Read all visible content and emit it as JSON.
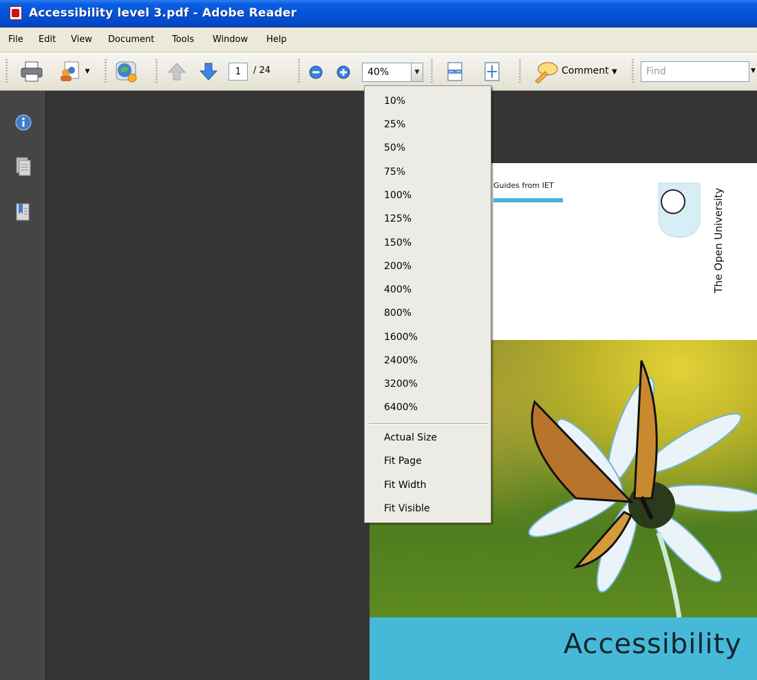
{
  "window": {
    "title": "Accessibility level 3.pdf - Adobe Reader"
  },
  "menubar": [
    "File",
    "Edit",
    "View",
    "Document",
    "Tools",
    "Window",
    "Help"
  ],
  "toolbar": {
    "page_current": "1",
    "page_total": "/ 24",
    "zoom_value": "40%",
    "comment_label": "Comment",
    "find_placeholder": "Find",
    "icons": [
      "print-icon",
      "collaborate-icon",
      "secure-icon",
      "previous-page-icon",
      "next-page-icon",
      "zoom-out-icon",
      "zoom-in-icon",
      "fit-width-icon",
      "fit-page-icon",
      "comment-icon"
    ]
  },
  "sidebar": {
    "icons": [
      "info-icon",
      "pages-icon",
      "bookmarks-icon"
    ]
  },
  "zoom_menu": {
    "percent_items": [
      "10%",
      "25%",
      "50%",
      "75%",
      "100%",
      "125%",
      "150%",
      "200%",
      "400%",
      "800%",
      "1600%",
      "2400%",
      "3200%",
      "6400%"
    ],
    "fit_items": [
      "Actual Size",
      "Fit Page",
      "Fit Width",
      "Fit Visible"
    ]
  },
  "document": {
    "guides_text": "Guides from IET",
    "publisher_text": "The Open University",
    "cover_title": "Accessibility"
  },
  "colors": {
    "title_bar": "#0553d8",
    "cover_band": "#46b9d8",
    "menu_bg": "#ecebe6",
    "doc_bg": "#363636"
  }
}
